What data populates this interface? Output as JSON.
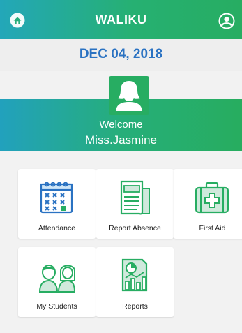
{
  "app": {
    "title": "WALIKU"
  },
  "date": "DEC 04, 2018",
  "hero": {
    "welcome": "Welcome",
    "name": "Miss.Jasmine"
  },
  "menu": [
    {
      "label": "Attendance",
      "icon": "calendar-icon"
    },
    {
      "label": "Report Absence",
      "icon": "document-icon"
    },
    {
      "label": "First Aid",
      "icon": "first-aid-kit-icon"
    },
    {
      "label": "My Students",
      "icon": "students-icon"
    },
    {
      "label": "Reports",
      "icon": "report-chart-icon"
    }
  ],
  "colors": {
    "primary_green": "#27ad62",
    "teal": "#23a7b9",
    "date_blue": "#2a72c2"
  }
}
